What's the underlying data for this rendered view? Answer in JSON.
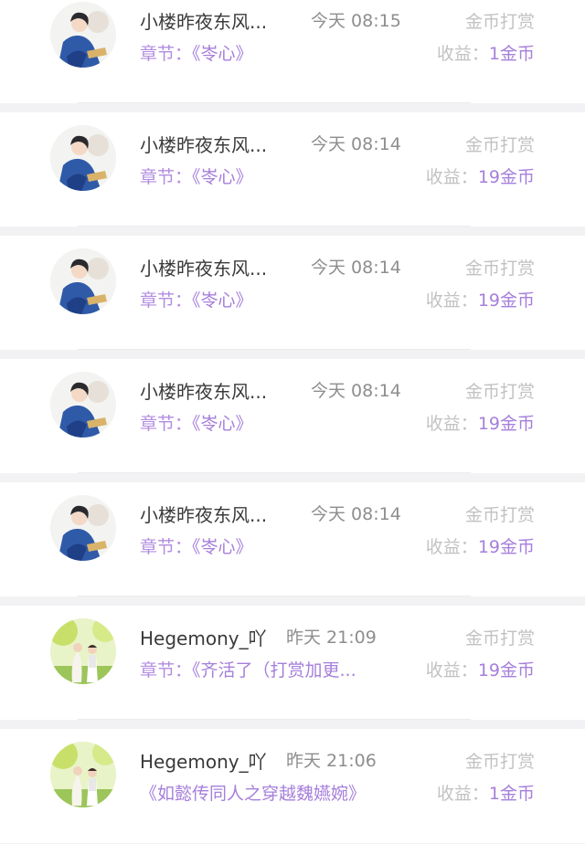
{
  "rewards": [
    {
      "user": "小楼昨夜东风...",
      "time": "今天 08:15",
      "type": "金币打赏",
      "chapter_label": "章节：",
      "chapter": "《岺心》",
      "income_label": "收益：",
      "income": "1金币",
      "avatar": "portrait-blue-robe"
    },
    {
      "user": "小楼昨夜东风...",
      "time": "今天 08:14",
      "type": "金币打赏",
      "chapter_label": "章节：",
      "chapter": "《岺心》",
      "income_label": "收益：",
      "income": "19金币",
      "avatar": "portrait-blue-robe"
    },
    {
      "user": "小楼昨夜东风...",
      "time": "今天 08:14",
      "type": "金币打赏",
      "chapter_label": "章节：",
      "chapter": "《岺心》",
      "income_label": "收益：",
      "income": "19金币",
      "avatar": "portrait-blue-robe"
    },
    {
      "user": "小楼昨夜东风...",
      "time": "今天 08:14",
      "type": "金币打赏",
      "chapter_label": "章节：",
      "chapter": "《岺心》",
      "income_label": "收益：",
      "income": "19金币",
      "avatar": "portrait-blue-robe"
    },
    {
      "user": "小楼昨夜东风...",
      "time": "今天 08:14",
      "type": "金币打赏",
      "chapter_label": "章节：",
      "chapter": "《岺心》",
      "income_label": "收益：",
      "income": "19金币",
      "avatar": "portrait-blue-robe"
    },
    {
      "user": "Hegemony_吖",
      "time": "昨天 21:09",
      "type": "金币打赏",
      "chapter_label": "章节：",
      "chapter": "《齐活了（打赏加更...",
      "income_label": "收益：",
      "income": "19金币",
      "avatar": "wedding-couple"
    },
    {
      "user": "Hegemony_吖",
      "time": "昨天 21:06",
      "type": "金币打赏",
      "chapter_label": "",
      "chapter": "《如懿传同人之穿越魏嬿婉》",
      "income_label": "收益：",
      "income": "1金币",
      "avatar": "wedding-couple"
    }
  ],
  "colors": {
    "accent": "#a67fdb",
    "muted": "#c2c2c2",
    "name": "#3a3a3a"
  }
}
